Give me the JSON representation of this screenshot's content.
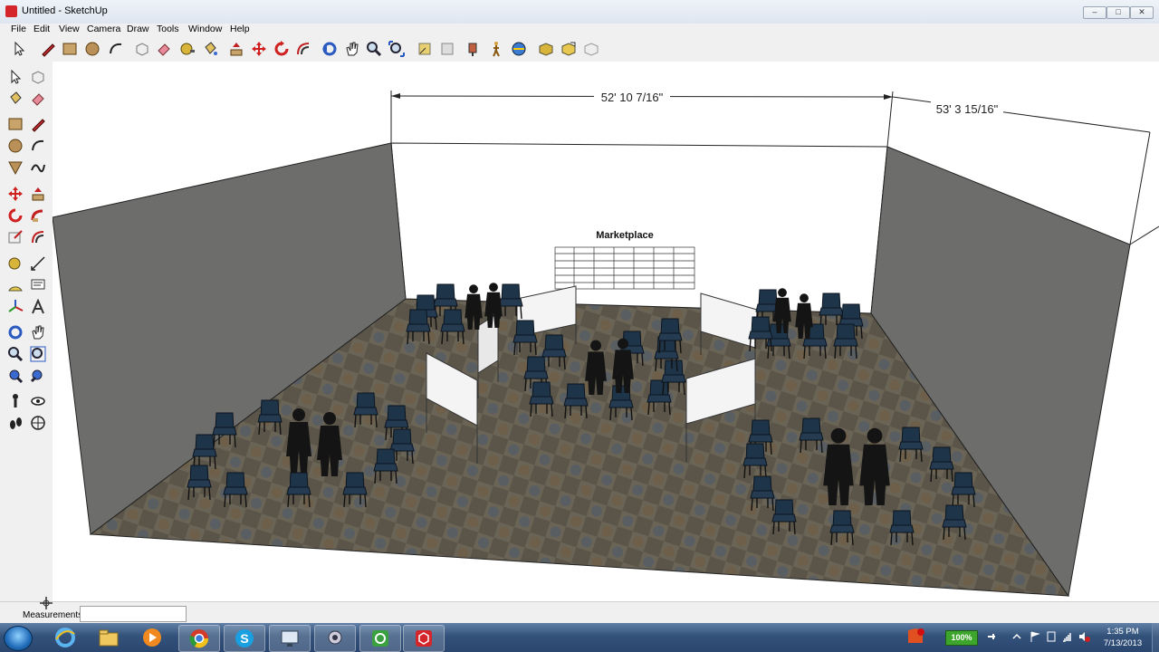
{
  "window": {
    "title": "Untitled - SketchUp",
    "controls": [
      "–",
      "□",
      "✕"
    ]
  },
  "menu": [
    "File",
    "Edit",
    "View",
    "Camera",
    "Draw",
    "Tools",
    "Window",
    "Help"
  ],
  "toolbar_top": [
    "select",
    "eraser",
    "pencil",
    "rectangle",
    "circle",
    "arc",
    "make-component",
    "paint-bucket",
    "push-pull",
    "follow-me",
    "move",
    "rotate",
    "offset",
    "orbit",
    "pan",
    "zoom",
    "zoom-extents",
    "previous-view",
    "next-view",
    "position-camera",
    "walk",
    "look-around",
    "get-models",
    "share-model",
    "share-component",
    "extension-warehouse"
  ],
  "toolbar_left": [
    "select",
    "make-component",
    "paint-bucket",
    "eraser",
    "rectangle",
    "line",
    "circle",
    "arc",
    "polygon",
    "freehand",
    "move",
    "push-pull",
    "rotate",
    "follow-me",
    "scale",
    "offset",
    "tape-measure",
    "dimension",
    "protractor",
    "text",
    "axes",
    "3d-text",
    "orbit",
    "pan",
    "zoom",
    "zoom-window",
    "zoom-extents",
    "previous-view",
    "position-camera",
    "look-around",
    "walk",
    "section-plane"
  ],
  "viewport": {
    "dimension_width": "52' 10 7/16\"",
    "dimension_depth": "53' 3 15/16\"",
    "wall_sign": "Marketplace"
  },
  "status": {
    "measurements_label": "Measurements",
    "measurements_value": ""
  },
  "taskbar": {
    "apps": [
      "windows-explorer",
      "internet-explorer",
      "file-explorer",
      "media-player",
      "chrome",
      "skype",
      "remote-desktop",
      "webcam",
      "camtasia",
      "sketchup"
    ],
    "battery": "100%",
    "time": "1:35 PM",
    "date": "7/13/2013"
  },
  "colors": {
    "wall_side": "#6d6d6b",
    "floor": "#5a5548",
    "chair": "#1e3448",
    "person": "#141414",
    "taskbar": "#33527a",
    "battery": "#3da52b"
  }
}
